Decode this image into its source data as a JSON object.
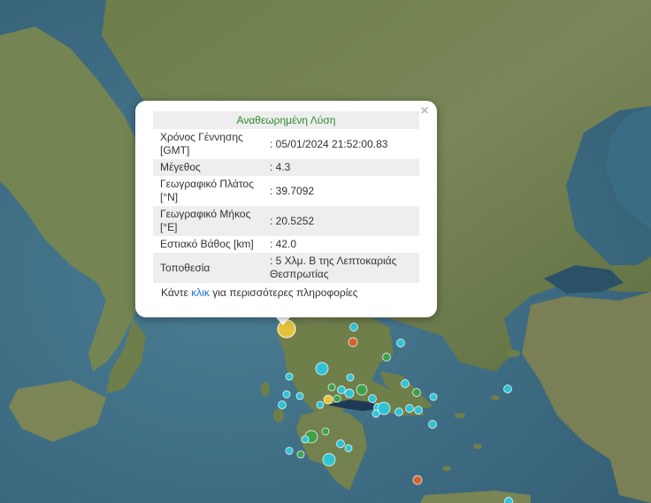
{
  "popup": {
    "header": "Αναθεωρημένη Λύση",
    "close_label": "×",
    "rows": [
      {
        "label": "Χρόνος Γέννησης [GMT]",
        "value": ": 05/01/2024 21:52:00.83"
      },
      {
        "label": "Μέγεθος",
        "value": ": 4.3"
      },
      {
        "label": "Γεωγραφικό Πλάτος [°N]",
        "value": ": 39.7092"
      },
      {
        "label": "Γεωγραφικό Μήκος [°E]",
        "value": ": 20.5252"
      },
      {
        "label": "Εστιακό Βάθος [km]",
        "value": ": 42.0"
      },
      {
        "label": "Τοποθεσία",
        "value": ": 5 Χλμ. Β της Λεπτοκαριάς Θεσπρωτίας"
      }
    ],
    "more_prefix": "Κάντε",
    "more_link": "κλικ",
    "more_suffix": "για περισσότερες πληροφορίες"
  },
  "selected_event": {
    "magnitude": 4.3,
    "latitude": 39.7092,
    "longitude": 20.5252,
    "color": "#e3c33a"
  },
  "colors": {
    "sea": "#3f6e86",
    "land": "#6d7f4e",
    "recent_event": "#2fc3d6",
    "older_event": "#3ea04a",
    "orange_event": "#d4622a",
    "yellow_event": "#e3c33a"
  }
}
